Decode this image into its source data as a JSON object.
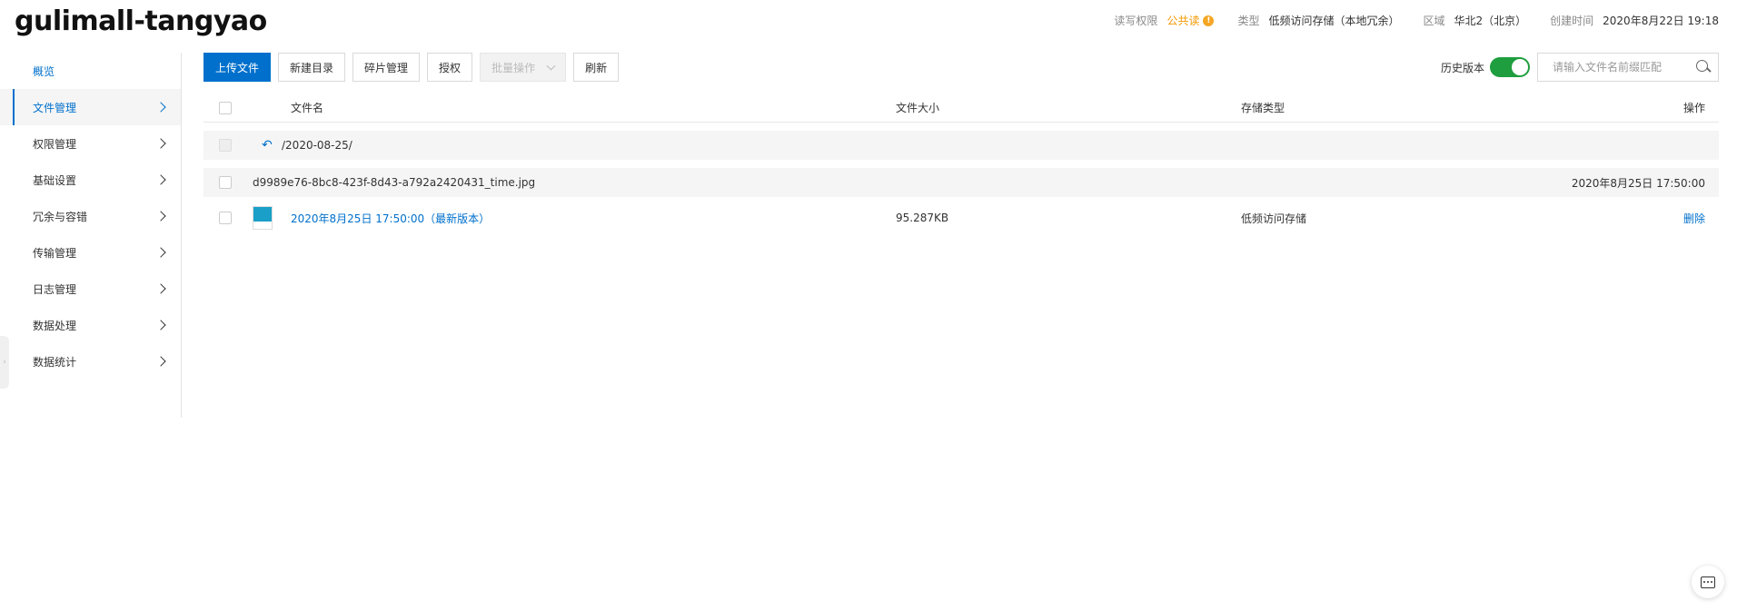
{
  "header": {
    "title": "gulimall-tangyao",
    "meta": {
      "acl_label": "读写权限",
      "acl_value": "公共读",
      "acl_warn_icon": "!",
      "type_label": "类型",
      "type_value": "低频访问存储（本地冗余）",
      "region_label": "区域",
      "region_value": "华北2（北京）",
      "created_label": "创建时间",
      "created_value": "2020年8月22日 19:18"
    }
  },
  "sidebar": {
    "items": [
      {
        "label": "概览"
      },
      {
        "label": "文件管理"
      },
      {
        "label": "权限管理"
      },
      {
        "label": "基础设置"
      },
      {
        "label": "冗余与容错"
      },
      {
        "label": "传输管理"
      },
      {
        "label": "日志管理"
      },
      {
        "label": "数据处理"
      },
      {
        "label": "数据统计"
      }
    ],
    "collapse_glyph": "›"
  },
  "toolbar": {
    "upload": "上传文件",
    "new_dir": "新建目录",
    "fragments": "碎片管理",
    "authorize": "授权",
    "batch": "批量操作",
    "refresh": "刷新"
  },
  "history": {
    "label": "历史版本",
    "enabled": true
  },
  "search": {
    "placeholder": "请输入文件名前缀匹配"
  },
  "table": {
    "headers": {
      "name": "文件名",
      "size": "文件大小",
      "type": "存储类型",
      "op": "操作"
    },
    "back_path": "/2020-08-25/",
    "back_glyph": "↶",
    "file": {
      "name": "d9989e76-8bc8-423f-8d43-a792a2420431_time.jpg",
      "date": "2020年8月25日 17:50:00"
    },
    "version": {
      "label": "2020年8月25日 17:50:00（最新版本）",
      "size": "95.287KB",
      "type": "低频访问存储",
      "action": "删除"
    }
  },
  "colors": {
    "accent": "#0070cc",
    "warn": "#f39800",
    "toggle_on": "#1e9e3e"
  }
}
